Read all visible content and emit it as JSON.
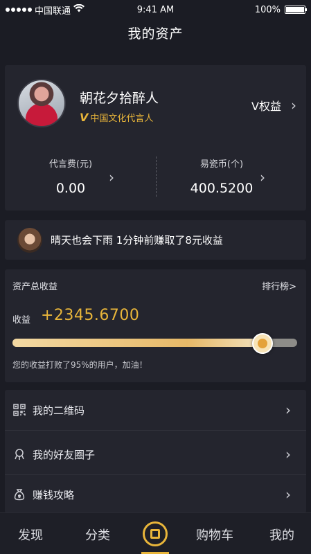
{
  "status_bar": {
    "carrier": "中国联通",
    "time": "9:41 AM",
    "battery": "100%"
  },
  "nav": {
    "title": "我的资产"
  },
  "profile": {
    "name": "朝花夕拾醉人",
    "badge_mark": "V",
    "badge_text": "中国文化代言人",
    "vip_label": "V权益"
  },
  "stats": [
    {
      "label": "代言费(元)",
      "value": "0.00"
    },
    {
      "label": "易瓷币(个)",
      "value": "400.5200"
    }
  ],
  "notice": {
    "text": "晴天也会下雨 1分钟前赚取了8元收益"
  },
  "earnings": {
    "title": "资产总收益",
    "rank_link": "排行榜>",
    "label": "收益",
    "value": "+2345.6700",
    "progress_percent": 95,
    "note": "您的收益打败了95%的用户，加油！"
  },
  "menu": [
    {
      "label": "我的二维码",
      "icon": "qr-code-icon"
    },
    {
      "label": "我的好友圈子",
      "icon": "friends-circle-icon"
    },
    {
      "label": "赚钱攻略",
      "icon": "money-bag-icon"
    }
  ],
  "tabbar": [
    {
      "label": "发现"
    },
    {
      "label": "分类"
    },
    {
      "label": "",
      "icon": "coin-icon",
      "active": true
    },
    {
      "label": "购物车"
    },
    {
      "label": "我的"
    }
  ],
  "colors": {
    "accent": "#e8b53a",
    "background": "#1b1c24",
    "card": "#24252e"
  }
}
